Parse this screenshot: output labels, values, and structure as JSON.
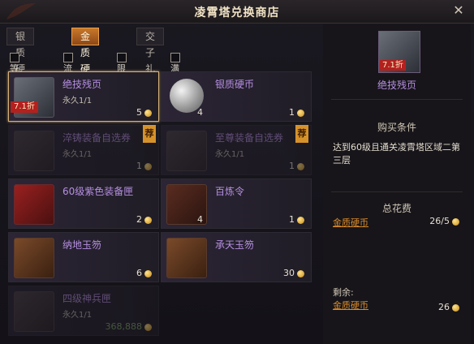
{
  "window": {
    "title": "凌霄塔兑换商店"
  },
  "tabs": [
    {
      "label": "银质硬币"
    },
    {
      "label": "金质硬币",
      "active": true
    },
    {
      "label": "交子礼包"
    }
  ],
  "filters": [
    {
      "label": "等级筛选"
    },
    {
      "label": "流派筛选"
    },
    {
      "label": "限购筛选"
    },
    {
      "label": "满足条件"
    }
  ],
  "items": [
    {
      "name": "绝技残页",
      "sub": "永久1/1",
      "price": "5",
      "discount": "7.1折",
      "icon": "book-icon",
      "selected": true
    },
    {
      "name": "银质硬币",
      "qty": "4",
      "price": "1",
      "icon": "silver-coin-icon"
    },
    {
      "name": "淬铸装备自选券",
      "sub": "永久1/1",
      "price": "1",
      "recommend": "荐",
      "icon": "voucher-icon",
      "dim": true
    },
    {
      "name": "至尊装备自选券",
      "sub": "永久1/1",
      "price": "1",
      "recommend": "荐",
      "icon": "voucher-icon",
      "dim": true
    },
    {
      "name": "60级紫色装备匣",
      "price": "2",
      "icon": "chest-icon"
    },
    {
      "name": "百炼令",
      "qty": "4",
      "price": "1",
      "icon": "token-icon"
    },
    {
      "name": "纳地玉笏",
      "price": "6",
      "icon": "jade-tablet-icon"
    },
    {
      "name": "承天玉笏",
      "price": "30",
      "icon": "jade-tablet-icon"
    },
    {
      "name": "四级神兵匣",
      "sub": "永久1/1",
      "price": "368,888",
      "icon": "weapon-box-icon",
      "dim": true
    }
  ],
  "detail": {
    "name": "绝技残页",
    "discount": "7.1折",
    "condition_heading": "购买条件",
    "condition_text": "达到60级且通关凌霄塔区域二第三层",
    "cost_heading": "总花费",
    "cost_currency": "金质硬币",
    "cost_value": "26/5",
    "remain_label": "剩余:",
    "remain_currency": "金质硬币",
    "remain_value": "26"
  },
  "colors": {
    "accent": "#d88a2a",
    "item_purple": "#b58fe0",
    "discount_red": "#b3201e"
  }
}
